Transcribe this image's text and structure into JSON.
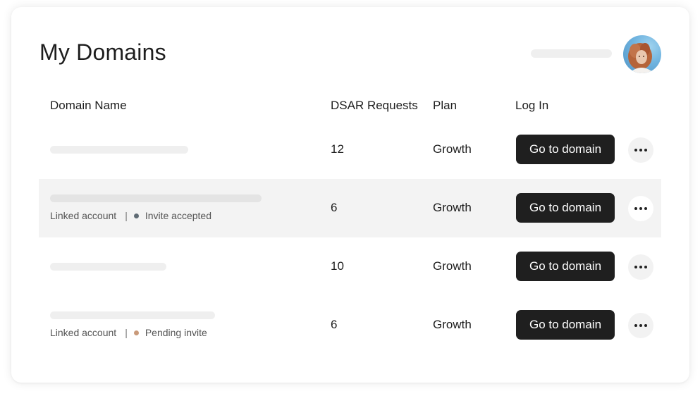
{
  "page": {
    "title": "My Domains"
  },
  "table": {
    "headers": {
      "domain_name": "Domain Name",
      "dsar_requests": "DSAR Requests",
      "plan": "Plan",
      "log_in": "Log In"
    },
    "rows": [
      {
        "dsar_requests": "12",
        "plan": "Growth",
        "button_label": "Go to domain",
        "linked_label": "",
        "status_label": "",
        "status_color": ""
      },
      {
        "dsar_requests": "6",
        "plan": "Growth",
        "button_label": "Go to domain",
        "linked_label": "Linked account",
        "separator": "|",
        "status_label": "Invite accepted",
        "status_color": "#5f6b74"
      },
      {
        "dsar_requests": "10",
        "plan": "Growth",
        "button_label": "Go to domain",
        "linked_label": "",
        "status_label": "",
        "status_color": ""
      },
      {
        "dsar_requests": "6",
        "plan": "Growth",
        "button_label": "Go to domain",
        "linked_label": "Linked account",
        "separator": "|",
        "status_label": "Pending invite",
        "status_color": "#c99a7a"
      }
    ]
  },
  "icons": {
    "more": "more-horizontal-icon",
    "avatar": "user-avatar"
  },
  "colors": {
    "button_bg": "#1f1f1f",
    "highlight_row_bg": "#f3f3f3",
    "skeleton": "#efefef"
  }
}
